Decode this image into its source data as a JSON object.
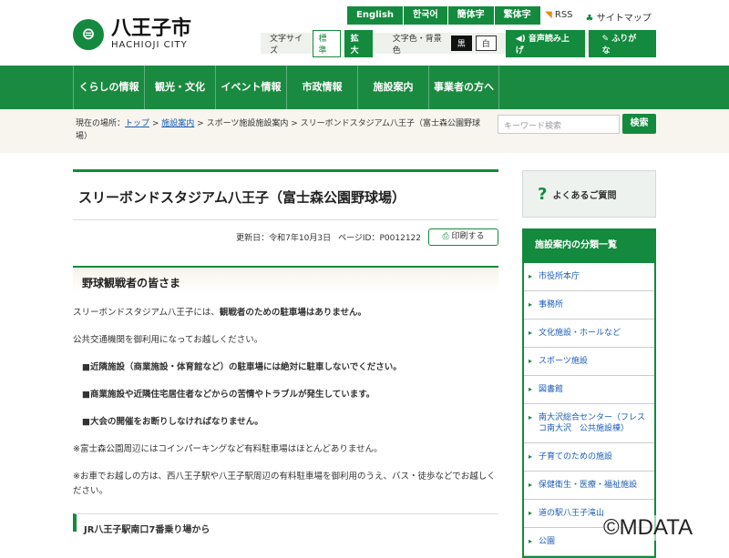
{
  "header": {
    "logo_jp": "八王子市",
    "logo_en": "HACHIOJI CITY",
    "logo_mark": "卍",
    "languages": [
      "English",
      "한국어",
      "簡体字",
      "繁体字"
    ],
    "rss": "RSS",
    "sitemap": "サイトマップ",
    "font_size_label": "文字サイズ",
    "font_standard": "標準",
    "font_large": "拡大",
    "color_label": "文字色・背景色",
    "color_black": "黒",
    "color_white": "白",
    "read_aloud": "音声読み上げ",
    "furigana": "ふりがな"
  },
  "nav": [
    "くらしの情報",
    "観光・文化",
    "イベント情報",
    "市政情報",
    "施設案内",
    "事業者の方へ"
  ],
  "breadcrumb": {
    "label": "現在の場所：",
    "top": "トップ",
    "facility": "施設案内",
    "rest": " > スポーツ施設施設案内 > スリーボンドスタジアム八王子（富士森公園野球場）"
  },
  "search": {
    "placeholder": "キーワード検索",
    "button": "検索"
  },
  "main": {
    "title": "スリーボンドスタジアム八王子（富士森公園野球場）",
    "updated": "更新日：令和7年10月3日",
    "page_id": "ページID：P0012122",
    "print": "印刷する",
    "section_title": "野球観戦者の皆さま",
    "p1_normal": "スリーボンドスタジアム八王子には、",
    "p1_bold": "観戦者のための駐車場はありません。",
    "p2": "公共交通機関を御利用になってお越しください。",
    "b1": "■近隣施設（商業施設・体育館など）の駐車場には絶対に駐車しないでください。",
    "b2": "■商業施設や近隣住宅居住者などからの苦情やトラブルが発生しています。",
    "b3": "■大会の開催をお断りしなければなりません。",
    "n1": "※富士森公園周辺にはコインパーキングなど有料駐車場はほとんどありません。",
    "n2": "※お車でお越しの方は、西八王子駅や八王子駅周辺の有料駐車場を御利用のうえ、バス・徒歩などでお越しください。",
    "next_heading": "JR八王子駅南口7番乗り場から"
  },
  "side": {
    "faq": "よくあるご質問",
    "category_title": "施設案内の分類一覧",
    "categories": [
      "市役所本庁",
      "事務所",
      "文化施設・ホールなど",
      "スポーツ施設",
      "図書館",
      "南大沢総合センター（フレスコ南大沢　公共施設棟）",
      "子育てのための施設",
      "保健衛生・医療・福祉施設",
      "道の駅八王子滝山",
      "公園"
    ]
  },
  "watermark": "©MDATA",
  "colors": {
    "brand_green": "#138a3e",
    "nav_green": "#1a8a40",
    "link": "#1a5bb5"
  }
}
